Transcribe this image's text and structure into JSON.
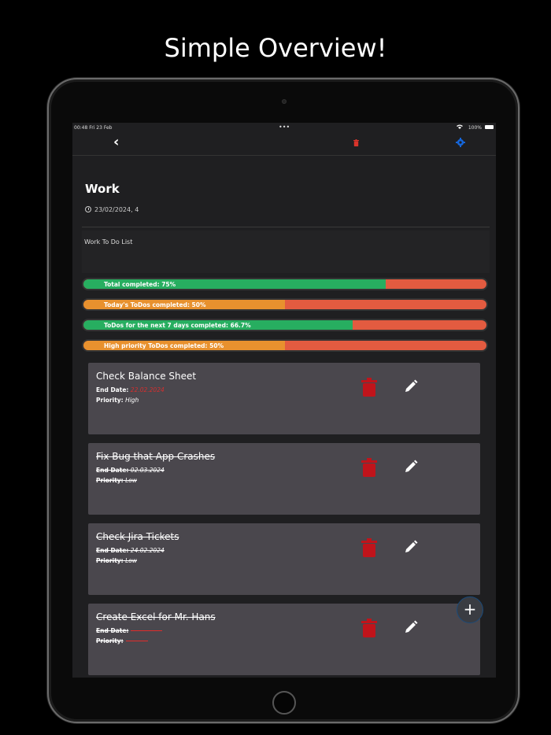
{
  "headline": "Simple Overview!",
  "status_bar": {
    "time": "00:48",
    "date": "Fri 23 Feb",
    "dots": "•••",
    "battery": "100%"
  },
  "nav": {
    "back_icon": "chevron-left-icon",
    "trash_icon": "trash-icon",
    "settings_icon": "gear-icon",
    "trash_color": "#d9342b",
    "settings_color": "#1565d8"
  },
  "list": {
    "title": "Work",
    "date": "23/02/2024, 4",
    "description": "Work To Do List"
  },
  "progress": [
    {
      "label": "Total completed: 75%",
      "value": 0.75,
      "color": "green"
    },
    {
      "label": "Today's ToDos completed: 50%",
      "value": 0.5,
      "color": "orange"
    },
    {
      "label": "ToDos for the next 7 days completed: 66.7%",
      "value": 0.667,
      "color": "green"
    },
    {
      "label": "High priority ToDos completed: 50%",
      "value": 0.5,
      "color": "orange"
    }
  ],
  "todos": [
    {
      "title": "Check Balance Sheet",
      "end_label": "End Date:",
      "end_value": "22.02.2024",
      "priority_label": "Priority:",
      "priority_value": "High",
      "done": false
    },
    {
      "title": "Fix Bug that App Crashes",
      "end_label": "End Date:",
      "end_value": "02.03.2024",
      "priority_label": "Priority:",
      "priority_value": "Low",
      "done": true
    },
    {
      "title": "Check Jira Tickets",
      "end_label": "End Date:",
      "end_value": "24.02.2024",
      "priority_label": "Priority:",
      "priority_value": "Low",
      "done": true
    },
    {
      "title": "Create Excel for Mr. Hans",
      "end_label": "End Date:",
      "end_value": "",
      "priority_label": "Priority:",
      "priority_value": "",
      "done": true
    }
  ],
  "fab_label": "+",
  "colors": {
    "delete": "#c0141b",
    "green": "#27ae60",
    "orange": "#e8912e",
    "red": "#e35b40",
    "card": "#4a474d"
  }
}
